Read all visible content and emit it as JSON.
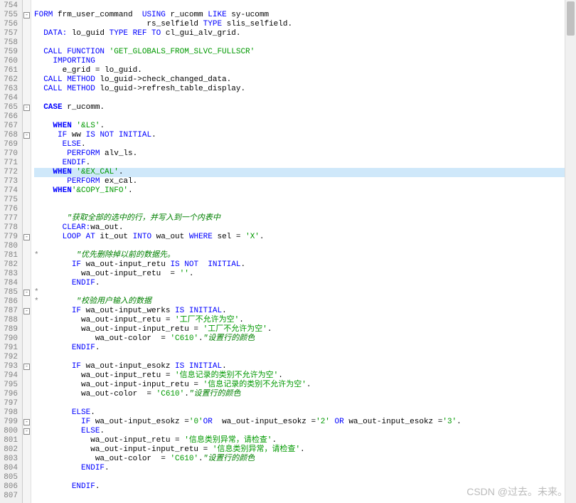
{
  "line_start": 754,
  "line_end": 807,
  "highlighted_line": 772,
  "fold_markers": {
    "755": "open",
    "765": "open",
    "768": "open",
    "779": "open",
    "785": "open",
    "787": "open",
    "793": "open",
    "799": "open",
    "800": "open"
  },
  "lines": {
    "754": [
      {
        "t": "",
        "c": ""
      }
    ],
    "755": [
      {
        "t": "FORM ",
        "c": "kw"
      },
      {
        "t": "frm_user_command  ",
        "c": "id"
      },
      {
        "t": "USING ",
        "c": "kw"
      },
      {
        "t": "r_ucomm ",
        "c": "id"
      },
      {
        "t": "LIKE ",
        "c": "kw"
      },
      {
        "t": "sy-ucomm",
        "c": "id"
      }
    ],
    "756": [
      {
        "t": "                        rs_selfield ",
        "c": "id"
      },
      {
        "t": "TYPE ",
        "c": "kw"
      },
      {
        "t": "slis_selfield.",
        "c": "id"
      }
    ],
    "757": [
      {
        "t": "  ",
        "c": ""
      },
      {
        "t": "DATA: ",
        "c": "kw"
      },
      {
        "t": "lo_guid ",
        "c": "id"
      },
      {
        "t": "TYPE REF TO ",
        "c": "kw"
      },
      {
        "t": "cl_gui_alv_grid.",
        "c": "id"
      }
    ],
    "758": [
      {
        "t": "",
        "c": ""
      }
    ],
    "759": [
      {
        "t": "  ",
        "c": ""
      },
      {
        "t": "CALL FUNCTION ",
        "c": "kw"
      },
      {
        "t": "'GET_GLOBALS_FROM_SLVC_FULLSCR'",
        "c": "str"
      }
    ],
    "760": [
      {
        "t": "    ",
        "c": ""
      },
      {
        "t": "IMPORTING",
        "c": "kw"
      }
    ],
    "761": [
      {
        "t": "      e_grid = lo_guid.",
        "c": "id"
      }
    ],
    "762": [
      {
        "t": "  ",
        "c": ""
      },
      {
        "t": "CALL METHOD ",
        "c": "kw"
      },
      {
        "t": "lo_guid->check_changed_data.",
        "c": "id"
      }
    ],
    "763": [
      {
        "t": "  ",
        "c": ""
      },
      {
        "t": "CALL METHOD ",
        "c": "kw"
      },
      {
        "t": "lo_guid->refresh_table_display.",
        "c": "id"
      }
    ],
    "764": [
      {
        "t": "",
        "c": ""
      }
    ],
    "765": [
      {
        "t": "  ",
        "c": ""
      },
      {
        "t": "CASE ",
        "c": "kw2"
      },
      {
        "t": "r_ucomm.",
        "c": "id"
      }
    ],
    "766": [
      {
        "t": "",
        "c": ""
      }
    ],
    "767": [
      {
        "t": "    ",
        "c": ""
      },
      {
        "t": "WHEN ",
        "c": "kw2"
      },
      {
        "t": "'&LS'",
        "c": "str"
      },
      {
        "t": ".",
        "c": "id"
      }
    ],
    "768": [
      {
        "t": "     ",
        "c": ""
      },
      {
        "t": "IF ",
        "c": "kw"
      },
      {
        "t": "ww ",
        "c": "id"
      },
      {
        "t": "IS NOT INITIAL",
        "c": "kw"
      },
      {
        "t": ".",
        "c": "id"
      }
    ],
    "769": [
      {
        "t": "      ",
        "c": ""
      },
      {
        "t": "ELSE",
        "c": "kw"
      },
      {
        "t": ".",
        "c": "id"
      }
    ],
    "770": [
      {
        "t": "       ",
        "c": ""
      },
      {
        "t": "PERFORM ",
        "c": "kw"
      },
      {
        "t": "alv_ls.",
        "c": "id"
      }
    ],
    "771": [
      {
        "t": "      ",
        "c": ""
      },
      {
        "t": "ENDIF",
        "c": "kw"
      },
      {
        "t": ".",
        "c": "id"
      }
    ],
    "772": [
      {
        "t": "    ",
        "c": ""
      },
      {
        "t": "WHEN ",
        "c": "kw2"
      },
      {
        "t": "'&EX_CAL'",
        "c": "str"
      },
      {
        "t": ".",
        "c": "id"
      }
    ],
    "773": [
      {
        "t": "       ",
        "c": ""
      },
      {
        "t": "PERFORM ",
        "c": "kw"
      },
      {
        "t": "ex_cal.",
        "c": "id"
      }
    ],
    "774": [
      {
        "t": "    ",
        "c": ""
      },
      {
        "t": "WHEN",
        "c": "kw2"
      },
      {
        "t": "'&COPY_INFO'",
        "c": "str"
      },
      {
        "t": ".",
        "c": "id"
      }
    ],
    "775": [
      {
        "t": "",
        "c": ""
      }
    ],
    "776": [
      {
        "t": "",
        "c": ""
      }
    ],
    "777": [
      {
        "t": "       ",
        "c": ""
      },
      {
        "t": "\"获取全部的选中的行，并写入到一个内表中",
        "c": "cmt"
      }
    ],
    "778": [
      {
        "t": "      ",
        "c": ""
      },
      {
        "t": "CLEAR:",
        "c": "kw"
      },
      {
        "t": "wa_out.",
        "c": "id"
      }
    ],
    "779": [
      {
        "t": "      ",
        "c": ""
      },
      {
        "t": "LOOP AT ",
        "c": "kw"
      },
      {
        "t": "it_out ",
        "c": "id"
      },
      {
        "t": "INTO ",
        "c": "kw"
      },
      {
        "t": "wa_out ",
        "c": "id"
      },
      {
        "t": "WHERE ",
        "c": "kw"
      },
      {
        "t": "sel = ",
        "c": "id"
      },
      {
        "t": "'X'",
        "c": "str"
      },
      {
        "t": ".",
        "c": "id"
      }
    ],
    "780": [
      {
        "t": "",
        "c": ""
      }
    ],
    "781": [
      {
        "t": "*        ",
        "c": "star"
      },
      {
        "t": "\"优先删除掉以前的数据先。",
        "c": "cmt"
      }
    ],
    "782": [
      {
        "t": "        ",
        "c": ""
      },
      {
        "t": "IF ",
        "c": "kw"
      },
      {
        "t": "wa_out-input_retu ",
        "c": "id"
      },
      {
        "t": "IS NOT  INITIAL",
        "c": "kw"
      },
      {
        "t": ".",
        "c": "id"
      }
    ],
    "783": [
      {
        "t": "          wa_out-input_retu  = ",
        "c": "id"
      },
      {
        "t": "''",
        "c": "str"
      },
      {
        "t": ".",
        "c": "id"
      }
    ],
    "784": [
      {
        "t": "        ",
        "c": ""
      },
      {
        "t": "ENDIF",
        "c": "kw"
      },
      {
        "t": ".",
        "c": "id"
      }
    ],
    "785": [
      {
        "t": "*",
        "c": "star"
      }
    ],
    "786": [
      {
        "t": "*        ",
        "c": "star"
      },
      {
        "t": "\"校验用户输入的数据",
        "c": "cmt"
      }
    ],
    "787": [
      {
        "t": "        ",
        "c": ""
      },
      {
        "t": "IF ",
        "c": "kw"
      },
      {
        "t": "wa_out-input_werks ",
        "c": "id"
      },
      {
        "t": "IS INITIAL",
        "c": "kw"
      },
      {
        "t": ".",
        "c": "id"
      }
    ],
    "788": [
      {
        "t": "          wa_out-input_retu = ",
        "c": "id"
      },
      {
        "t": "'工厂不允许为空'",
        "c": "str"
      },
      {
        "t": ".",
        "c": "id"
      }
    ],
    "789": [
      {
        "t": "          wa_out-input-input_retu = ",
        "c": "id"
      },
      {
        "t": "'工厂不允许为空'",
        "c": "str"
      },
      {
        "t": ".",
        "c": "id"
      }
    ],
    "790": [
      {
        "t": "             wa_out-color  = ",
        "c": "id"
      },
      {
        "t": "'C610'",
        "c": "str"
      },
      {
        "t": ".",
        "c": "id"
      },
      {
        "t": "\"设置行的颜色",
        "c": "cmt"
      }
    ],
    "791": [
      {
        "t": "        ",
        "c": ""
      },
      {
        "t": "ENDIF",
        "c": "kw"
      },
      {
        "t": ".",
        "c": "id"
      }
    ],
    "792": [
      {
        "t": "",
        "c": ""
      }
    ],
    "793": [
      {
        "t": "        ",
        "c": ""
      },
      {
        "t": "IF ",
        "c": "kw"
      },
      {
        "t": "wa_out-input_esokz ",
        "c": "id"
      },
      {
        "t": "IS INITIAL",
        "c": "kw"
      },
      {
        "t": ".",
        "c": "id"
      }
    ],
    "794": [
      {
        "t": "          wa_out-input_retu = ",
        "c": "id"
      },
      {
        "t": "'信息记录的类别不允许为空'",
        "c": "str"
      },
      {
        "t": ".",
        "c": "id"
      }
    ],
    "795": [
      {
        "t": "          wa_out-input-input_retu = ",
        "c": "id"
      },
      {
        "t": "'信息记录的类别不允许为空'",
        "c": "str"
      },
      {
        "t": ".",
        "c": "id"
      }
    ],
    "796": [
      {
        "t": "          wa_out-color  = ",
        "c": "id"
      },
      {
        "t": "'C610'",
        "c": "str"
      },
      {
        "t": ".",
        "c": "id"
      },
      {
        "t": "\"设置行的颜色",
        "c": "cmt"
      }
    ],
    "797": [
      {
        "t": "",
        "c": ""
      }
    ],
    "798": [
      {
        "t": "        ",
        "c": ""
      },
      {
        "t": "ELSE",
        "c": "kw"
      },
      {
        "t": ".",
        "c": "id"
      }
    ],
    "799": [
      {
        "t": "          ",
        "c": ""
      },
      {
        "t": "IF ",
        "c": "kw"
      },
      {
        "t": "wa_out-input_esokz =",
        "c": "id"
      },
      {
        "t": "'0'",
        "c": "str"
      },
      {
        "t": "OR  ",
        "c": "kw"
      },
      {
        "t": "wa_out-input_esokz =",
        "c": "id"
      },
      {
        "t": "'2' ",
        "c": "str"
      },
      {
        "t": "OR ",
        "c": "kw"
      },
      {
        "t": "wa_out-input_esokz =",
        "c": "id"
      },
      {
        "t": "'3'",
        "c": "str"
      },
      {
        "t": ".",
        "c": "id"
      }
    ],
    "800": [
      {
        "t": "          ",
        "c": ""
      },
      {
        "t": "ELSE",
        "c": "kw"
      },
      {
        "t": ".",
        "c": "id"
      }
    ],
    "801": [
      {
        "t": "            wa_out-input_retu = ",
        "c": "id"
      },
      {
        "t": "'信息类别异常，请检查'",
        "c": "str"
      },
      {
        "t": ".",
        "c": "id"
      }
    ],
    "802": [
      {
        "t": "            wa_out-input-input_retu = ",
        "c": "id"
      },
      {
        "t": "'信息类别异常，请检查'",
        "c": "str"
      },
      {
        "t": ".",
        "c": "id"
      }
    ],
    "803": [
      {
        "t": "             wa_out-color  = ",
        "c": "id"
      },
      {
        "t": "'C610'",
        "c": "str"
      },
      {
        "t": ".",
        "c": "id"
      },
      {
        "t": "\"设置行的颜色",
        "c": "cmt"
      }
    ],
    "804": [
      {
        "t": "          ",
        "c": ""
      },
      {
        "t": "ENDIF",
        "c": "kw"
      },
      {
        "t": ".",
        "c": "id"
      }
    ],
    "805": [
      {
        "t": "",
        "c": ""
      }
    ],
    "806": [
      {
        "t": "        ",
        "c": ""
      },
      {
        "t": "ENDIF",
        "c": "kw"
      },
      {
        "t": ".",
        "c": "id"
      }
    ],
    "807": [
      {
        "t": "",
        "c": ""
      }
    ]
  },
  "watermark": "CSDN @过去。未来。"
}
